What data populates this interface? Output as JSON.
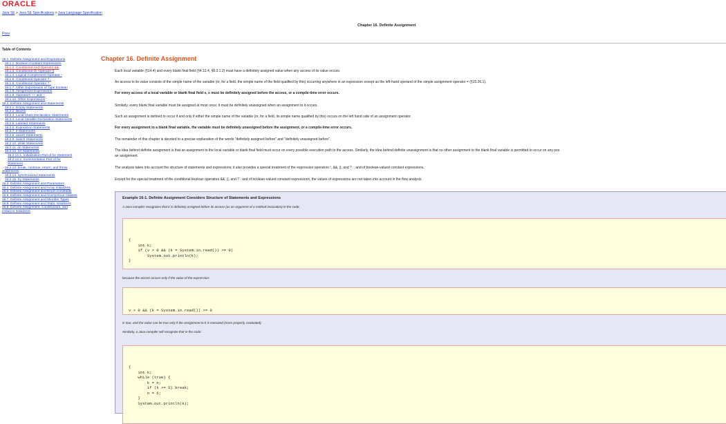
{
  "header": {
    "logo": "ORACLE",
    "breadcrumb": [
      "Java SE",
      "Java SE Specifications",
      "Java Language Specification"
    ],
    "breadcrumb_sep": " > ",
    "title": "Chapter 16. Definite Assignment",
    "prev": "Prev"
  },
  "toc": {
    "title": "Table of Contents",
    "items": [
      {
        "level": 1,
        "text": "16.1. Definite Assignment and Expressions"
      },
      {
        "level": 2,
        "text": "16.1.1. Boolean Constant Expressions"
      },
      {
        "level": 2,
        "text": "16.1.2. Conditional-And Operator &&",
        "current": true
      },
      {
        "level": 2,
        "text": "16.1.3. Conditional-Or Operator ||"
      },
      {
        "level": 2,
        "text": "16.1.4. Logical Complement Operator !"
      },
      {
        "level": 2,
        "text": "16.1.5. Conditional Operator ? :"
      },
      {
        "level": 2,
        "text": "16.1.6. Conditional Operator ? :"
      },
      {
        "level": 2,
        "text": "16.1.7. Other Expressions of Type boolean"
      },
      {
        "level": 2,
        "text": "16.1.8. Assignment Expressions"
      },
      {
        "level": 2,
        "text": "16.1.9. Operators ++ and --"
      },
      {
        "level": 2,
        "text": "16.1.10. Other Expressions"
      },
      {
        "level": 1,
        "text": "16.2. Definite Assignment and Statements"
      },
      {
        "level": 2,
        "text": "16.2.1. Empty Statements"
      },
      {
        "level": 2,
        "text": "16.2.2. Blocks"
      },
      {
        "level": 2,
        "text": "16.2.3. Local Class Declaration Statements"
      },
      {
        "level": 2,
        "text": "16.2.4. Local Variable Declaration Statements"
      },
      {
        "level": 2,
        "text": "16.2.5. Labeled Statements"
      },
      {
        "level": 2,
        "text": "16.2.6. Expression Statements"
      },
      {
        "level": 2,
        "text": "16.2.7. if Statements"
      },
      {
        "level": 2,
        "text": "16.2.8. assert Statements"
      },
      {
        "level": 2,
        "text": "16.2.9. switch Statements"
      },
      {
        "level": 2,
        "text": "16.2.10. while Statements"
      },
      {
        "level": 2,
        "text": "16.2.11. do Statements"
      },
      {
        "level": 2,
        "text": "16.2.12. for Statements"
      },
      {
        "level": 3,
        "text": "16.2.12.1. Initialization Part of for Statement"
      },
      {
        "level": 3,
        "text": "16.2.12.2. Incrementation Part of for"
      },
      {
        "level": 3,
        "text": "Statement"
      },
      {
        "level": 2,
        "text": "16.2.13. break, continue, return, and throw"
      },
      {
        "level": 1,
        "text": "Statements"
      },
      {
        "level": 2,
        "text": "16.2.14. synchronized Statements"
      },
      {
        "level": 2,
        "text": "16.2.15. try Statements"
      },
      {
        "level": 1,
        "text": "16.3. Definite Assignment and Parameters"
      },
      {
        "level": 1,
        "text": "16.4. Definite Assignment and Array Initializers"
      },
      {
        "level": 1,
        "text": "16.5. Definite Assignment and Enum Constants"
      },
      {
        "level": 1,
        "text": "16.6. Definite Assignment and Anonymous Classes"
      },
      {
        "level": 1,
        "text": "16.7. Definite Assignment and Member Types"
      },
      {
        "level": 1,
        "text": "16.8. Definite Assignment and Static Initializers"
      },
      {
        "level": 1,
        "text": "16.9. Definite Assignment, Constructors, and"
      },
      {
        "level": 1,
        "text": "Instance Initializers"
      }
    ]
  },
  "main": {
    "chapter_title": "Chapter 16. Definite Assignment",
    "paragraphs": [
      {
        "text": "Each local variable (§14.4) and every blank final field (§4.12.4, §8.3.1.2) must have a definitely assigned value when any access of its value occurs."
      },
      {
        "text": "An access to its value consists of the simple name of the variable (or, for a field, the simple name of the field qualified by this) occurring anywhere in an expression except as the left-hand operand of the simple assignment operator = (§15.26.1)."
      },
      {
        "text": "For every access of a local variable or blank final field x, x must be definitely assigned before the access, or a compile-time error occurs.",
        "bold": true
      },
      {
        "text": "Similarly, every blank final variable must be assigned at most once; it must be definitely unassigned when an assignment to it occurs."
      },
      {
        "text": "Such an assignment is defined to occur if and only if either the simple name of the variable (or, for a field, its simple name qualified by this) occurs on the left hand side of an assignment operator."
      },
      {
        "text": "For every assignment to a blank final variable, the variable must be definitely unassigned before the assignment, or a compile-time error occurs.",
        "bold": true
      },
      {
        "text": "The remainder of this chapter is devoted to a precise explanation of the words \"definitely assigned before\" and \"definitely unassigned before\"."
      },
      {
        "text": "The idea behind definite assignment is that an assignment to the local variable or blank final field must occur on every possible execution path to the access. Similarly, the idea behind definite unassignment is that no other assignment to the blank final variable is permitted to occur on any pos"
      },
      {
        "text": "an assignment."
      },
      {
        "text": "The analysis takes into account the structure of statements and expressions; it also provides a special treatment of the expression operators !, &&, ||, and ? :, and of boolean-valued constant expressions."
      },
      {
        "text": "Except for the special treatment of the conditional boolean operators &&, ||, and ? : and of boolean-valued constant expressions, the values of expressions are not taken into account in the flow analysis."
      }
    ],
    "example": {
      "title": "Example 16-1. Definite Assignment Considers Structure of Statements and Expressions",
      "note1": "A Java compiler recognizes that k is definitely assigned before its access (as an argument of a method invocation) in the code:",
      "code1": "{\n    int k;\n    if (v > 0 && (k = System.in.read()) >= 0)\n        System.out.println(k);\n}",
      "note2": "because the access occurs only if the value of the expression:",
      "code2": "v > 0 && (k = System.in.read()) >= 0",
      "note3": "is true, and the value can be true only if the assignment to k is executed (more properly, evaluated).",
      "note4": "Similarly, a Java compiler will recognize that in the code:",
      "code3": "{\n    int k;\n    while (true) {\n        k = n;\n        if (k >= 5) break;\n        n = 6;\n    }\n    System.out.println(k);"
    }
  }
}
